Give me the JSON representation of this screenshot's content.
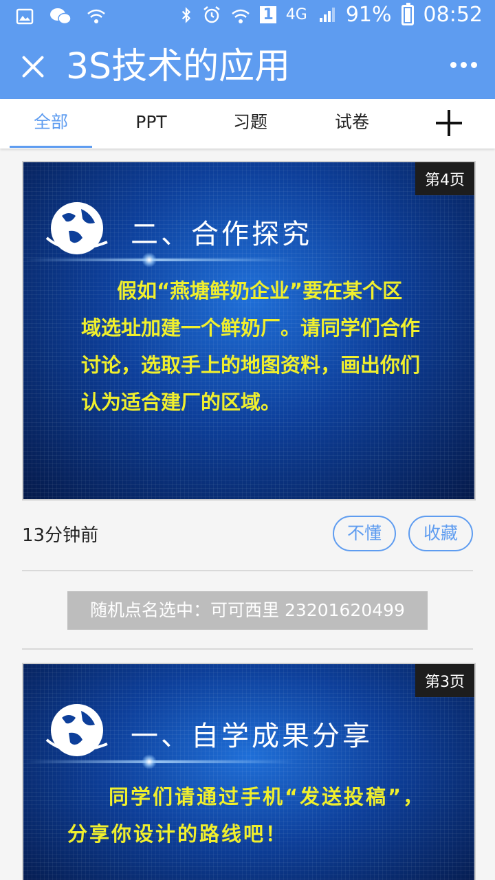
{
  "status_bar": {
    "battery_percent": "91%",
    "time": "08:52",
    "network": "4G",
    "sim": "1"
  },
  "app_bar": {
    "title": "3S技术的应用"
  },
  "tabs": [
    {
      "label": "全部",
      "active": true
    },
    {
      "label": "PPT",
      "active": false
    },
    {
      "label": "习题",
      "active": false
    },
    {
      "label": "试卷",
      "active": false
    }
  ],
  "slides": [
    {
      "page_badge": "第4页",
      "heading": "二、合作探究",
      "lines": [
        "假如“燕塘鲜奶企业”要在某个区",
        "域选址加建一个鲜奶厂。请同学们合作",
        "讨论，选取手上的地图资料，画出你们",
        "认为适合建厂的区域。"
      ],
      "time_ago": "13分钟前",
      "actions": {
        "dont_understand": "不懂",
        "favorite": "收藏"
      }
    },
    {
      "page_badge": "第3页",
      "heading": "一、自学成果分享",
      "lines": [
        "同学们请通过手机“发送投稿”，",
        "分享你设计的路线吧！"
      ]
    }
  ],
  "random_call": "随机点名选中：可可西里 23201620499",
  "colors": {
    "primary": "#5e9cf0",
    "slide_text": "#f0ef2d"
  }
}
